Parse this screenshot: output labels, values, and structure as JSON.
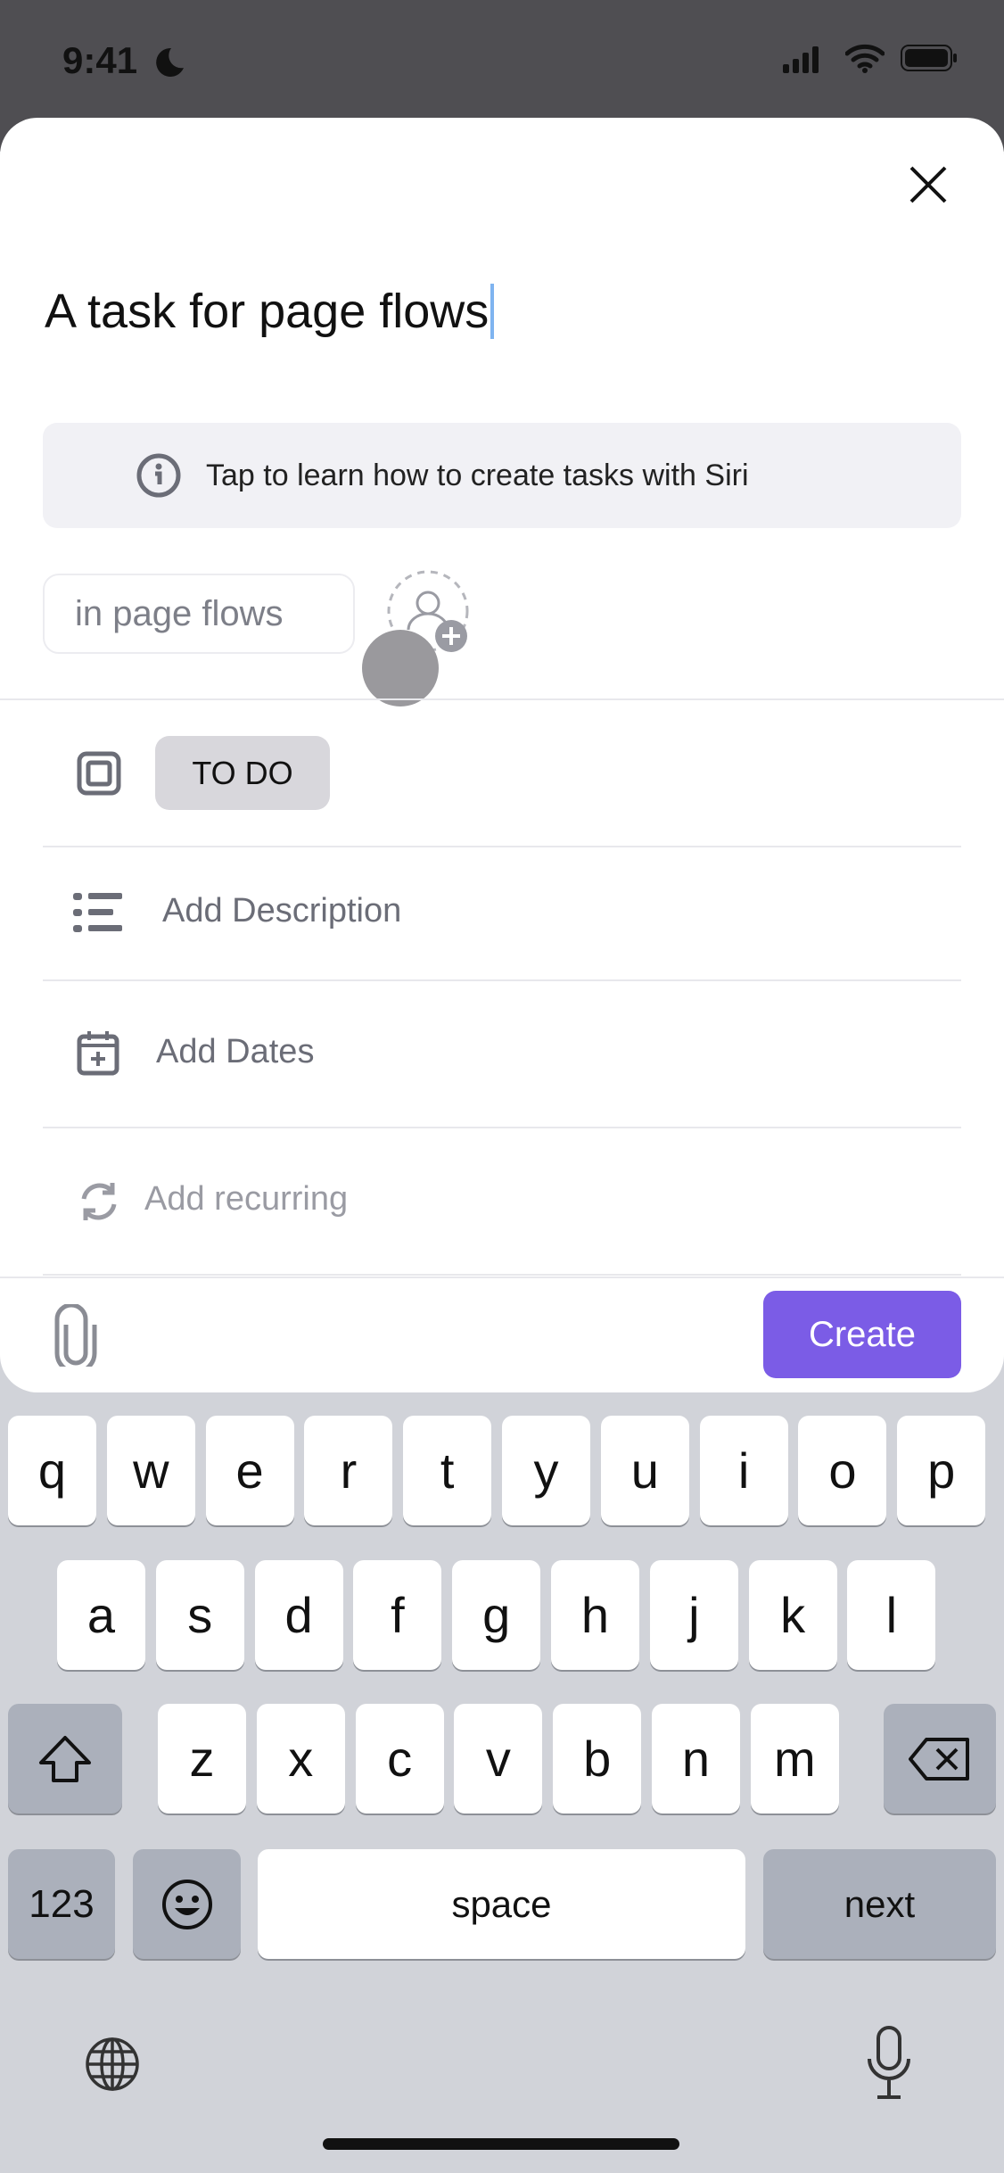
{
  "status_bar": {
    "time": "9:41"
  },
  "sheet": {
    "title_value": "A task for page flows",
    "siri_banner": "Tap to learn how to create tasks with Siri",
    "location_chip": {
      "prefix": "in",
      "name": "page flows"
    },
    "status_label": "TO DO",
    "description_placeholder": "Add Description",
    "dates_label": "Add Dates",
    "recurring_label": "Add recurring",
    "create_label": "Create"
  },
  "colors": {
    "accent": "#7b5ce6",
    "status_pill": "#d8d7dc",
    "banner": "#f1f1f5"
  },
  "keyboard": {
    "row1": [
      "q",
      "w",
      "e",
      "r",
      "t",
      "y",
      "u",
      "i",
      "o",
      "p"
    ],
    "row2": [
      "a",
      "s",
      "d",
      "f",
      "g",
      "h",
      "j",
      "k",
      "l"
    ],
    "row3": [
      "z",
      "x",
      "c",
      "v",
      "b",
      "n",
      "m"
    ],
    "numbers_label": "123",
    "space_label": "space",
    "return_label": "next"
  }
}
